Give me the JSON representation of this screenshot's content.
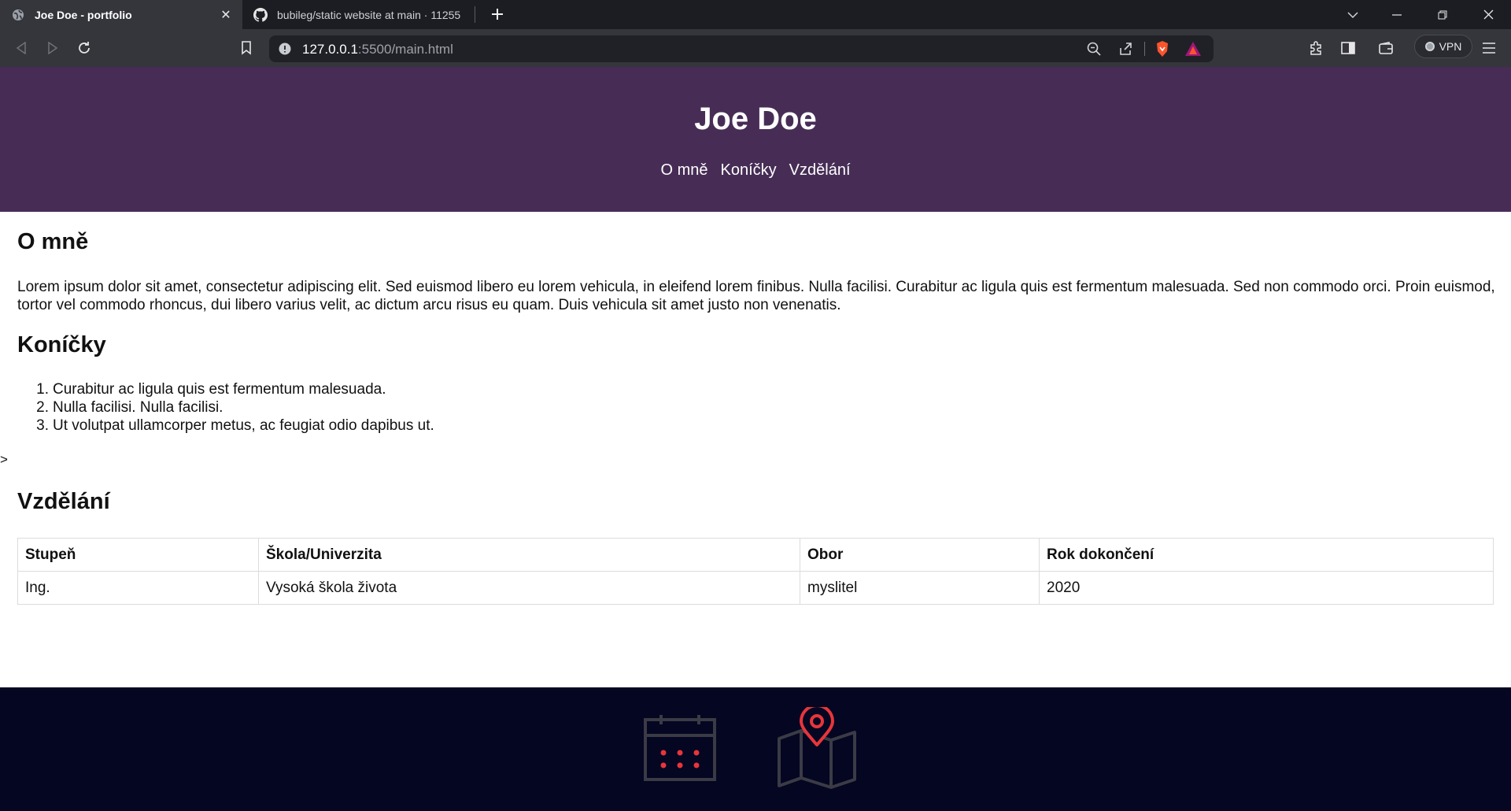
{
  "browser": {
    "tabs": [
      {
        "title": "Joe Doe - portfolio",
        "active": true,
        "icon": "globe-icon"
      },
      {
        "title": "bubileg/static website at main · 11255",
        "active": false,
        "icon": "github-icon"
      }
    ],
    "address": {
      "host": "127.0.0.1",
      "rest": ":5500/main.html"
    },
    "vpn_label": "VPN"
  },
  "page": {
    "site_title": "Joe Doe",
    "nav": [
      {
        "label": "O mně"
      },
      {
        "label": "Koníčky"
      },
      {
        "label": "Vzdělání"
      }
    ],
    "about": {
      "heading": "O mně",
      "text": "Lorem ipsum dolor sit amet, consectetur adipiscing elit. Sed euismod libero eu lorem vehicula, in eleifend lorem finibus. Nulla facilisi. Curabitur ac ligula quis est fermentum malesuada. Sed non commodo orci. Proin euismod, tortor vel commodo rhoncus, dui libero varius velit, ac dictum arcu risus eu quam. Duis vehicula sit amet justo non venenatis."
    },
    "hobbies": {
      "heading": "Koníčky",
      "items": [
        {
          "num": "1.",
          "text": "Curabitur ac ligula quis est fermentum malesuada."
        },
        {
          "num": "2.",
          "text": "Nulla facilisi. Nulla facilisi."
        },
        {
          "num": "3.",
          "text": "Ut volutpat ullamcorper metus, ac feugiat odio dapibus ut."
        }
      ]
    },
    "stray_char": ">",
    "education": {
      "heading": "Vzdělání",
      "columns": [
        "Stupeň",
        "Škola/Univerzita",
        "Obor",
        "Rok dokončení"
      ],
      "rows": [
        [
          "Ing.",
          "Vysoká škola života",
          "myslitel",
          "2020"
        ]
      ]
    },
    "footer": {
      "icons": [
        "calendar-icon",
        "map-pin-icon"
      ],
      "accent": "#e8353b"
    }
  },
  "colors": {
    "header_bg": "#472d56",
    "footer_bg": "#040622",
    "chrome_bg": "#35363c"
  }
}
